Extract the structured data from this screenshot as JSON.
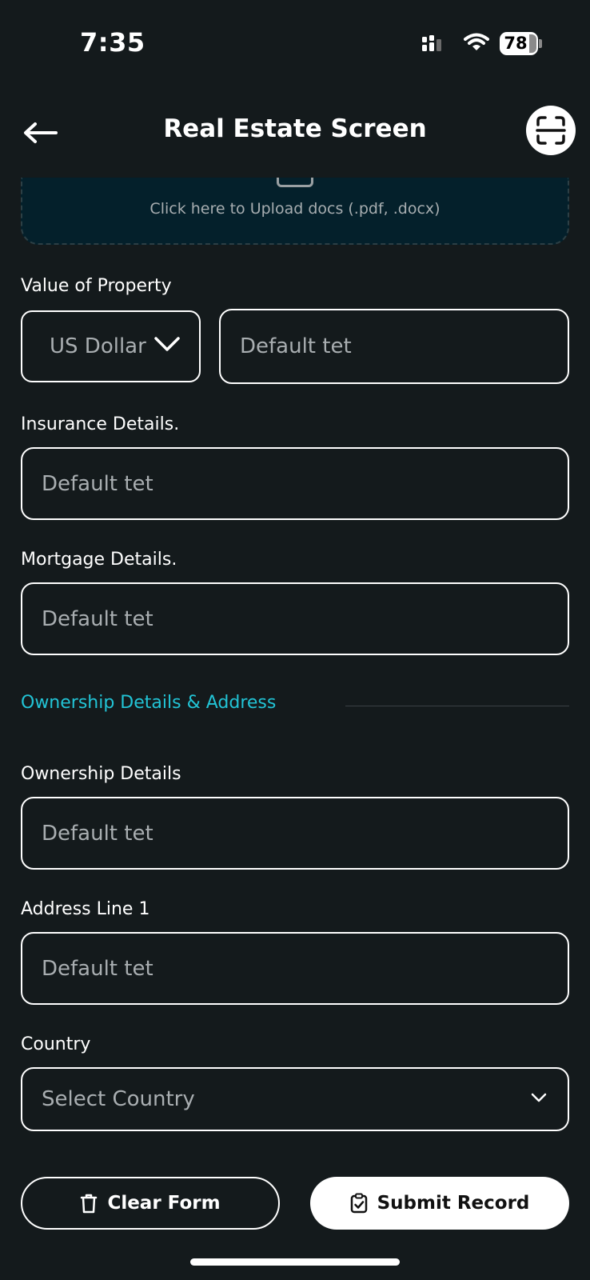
{
  "status_bar": {
    "time": "7:35",
    "battery": "78"
  },
  "header": {
    "title": "Real Estate Screen"
  },
  "upload": {
    "text": "Click here to Upload docs (.pdf, .docx)"
  },
  "property_value": {
    "label": "Value of Property",
    "currency": "US Dollar",
    "amount_placeholder": "Default tet"
  },
  "insurance": {
    "label": "Insurance Details.",
    "placeholder": "Default tet"
  },
  "mortgage": {
    "label": "Mortgage Details.",
    "placeholder": "Default tet"
  },
  "section": {
    "title": "Ownership Details & Address"
  },
  "ownership": {
    "label": "Ownership Details",
    "placeholder": "Default tet"
  },
  "address1": {
    "label": "Address Line 1",
    "placeholder": "Default tet"
  },
  "country": {
    "label": "Country",
    "placeholder": "Select Country"
  },
  "actions": {
    "clear_label": "Clear Form",
    "submit_label": "Submit Record"
  },
  "colors": {
    "background": "#141a1c",
    "accent": "#22c4d6",
    "upload_bg": "#04202b"
  },
  "icons": [
    "back-arrow-icon",
    "scan-icon",
    "chevron-down-icon",
    "trash-icon",
    "clipboard-check-icon"
  ]
}
